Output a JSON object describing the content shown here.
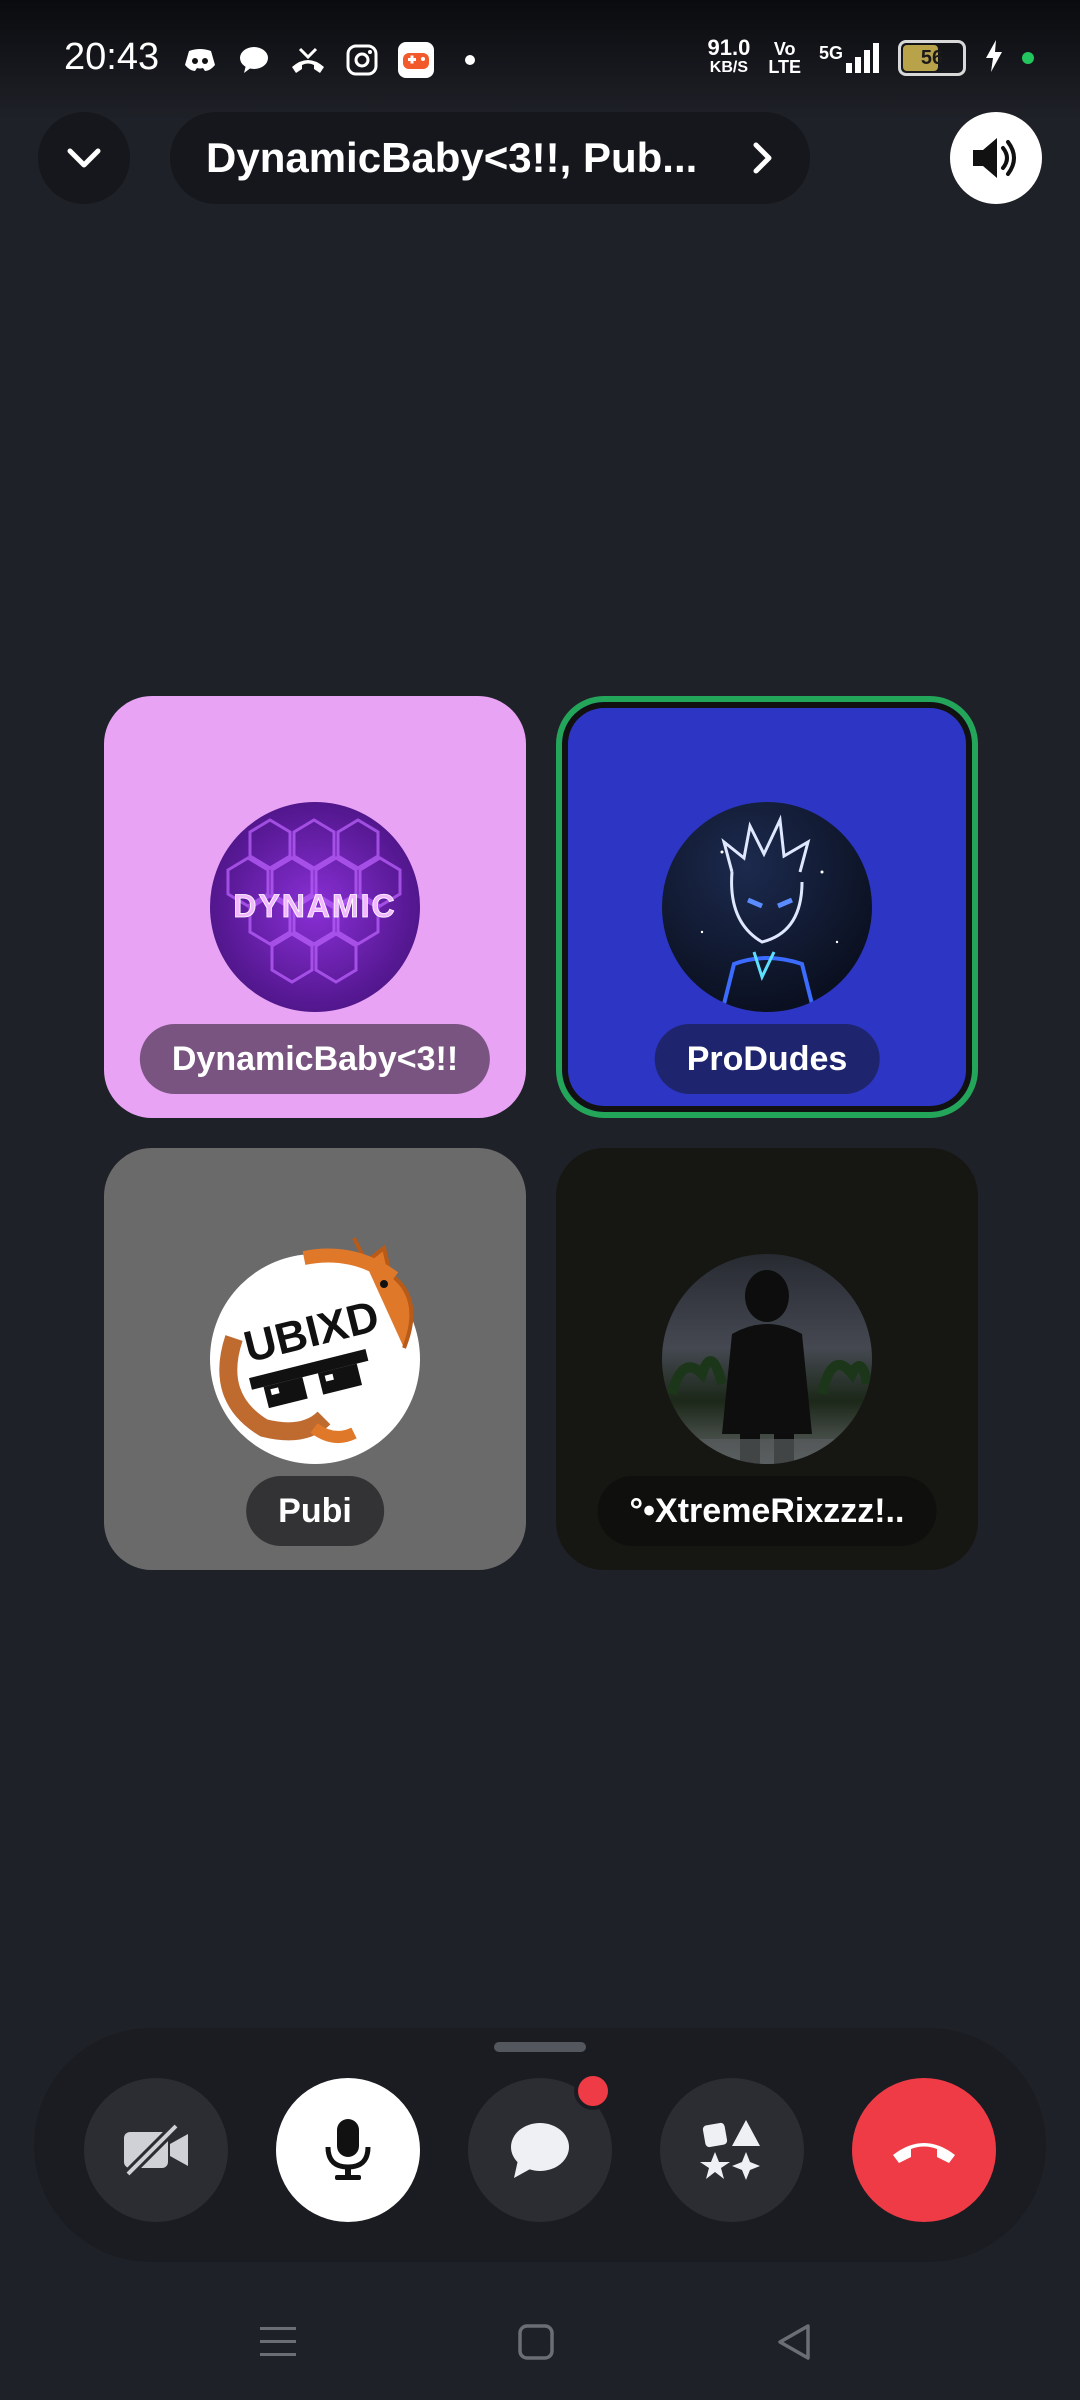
{
  "status_bar": {
    "time": "20:43",
    "net_speed_value": "91.0",
    "net_speed_unit": "KB/S",
    "volte_top": "Vo",
    "volte_bottom": "LTE",
    "network": "5G",
    "battery_level": "56",
    "icons": [
      "discord-icon",
      "chat-bubble-icon",
      "missed-call-icon",
      "instagram-icon",
      "game-app-icon",
      "notification-dot-icon"
    ]
  },
  "header": {
    "title": "DynamicBaby<3!!, Pub...",
    "collapse_icon": "chevron-down-icon",
    "open_icon": "chevron-right-icon",
    "speaker_icon": "speaker-icon"
  },
  "participants": [
    {
      "name": "DynamicBaby<3!!",
      "avatar_text": "DYNAMIC",
      "tile_color": "#e8a3f4",
      "speaking": false
    },
    {
      "name": "ProDudes",
      "tile_color": "#2c35c4",
      "speaking": true
    },
    {
      "name": "Pubi",
      "avatar_text": "UBIXD",
      "tile_color": "#6a6a6a",
      "speaking": false
    },
    {
      "name": "°•XtremeRixzzz!..",
      "tile_color": "#161713",
      "speaking": false
    }
  ],
  "controls": {
    "camera": "camera-off-icon",
    "mic": "microphone-icon",
    "chat": "chat-icon",
    "activities": "activities-icon",
    "end_call": "end-call-icon",
    "chat_badge": true
  },
  "nav": {
    "recents": "menu-icon",
    "home": "home-square-icon",
    "back": "back-triangle-icon"
  },
  "colors": {
    "background": "#1f2128",
    "speaking_ring": "#23a55a",
    "end_call": "#ef3b46"
  }
}
